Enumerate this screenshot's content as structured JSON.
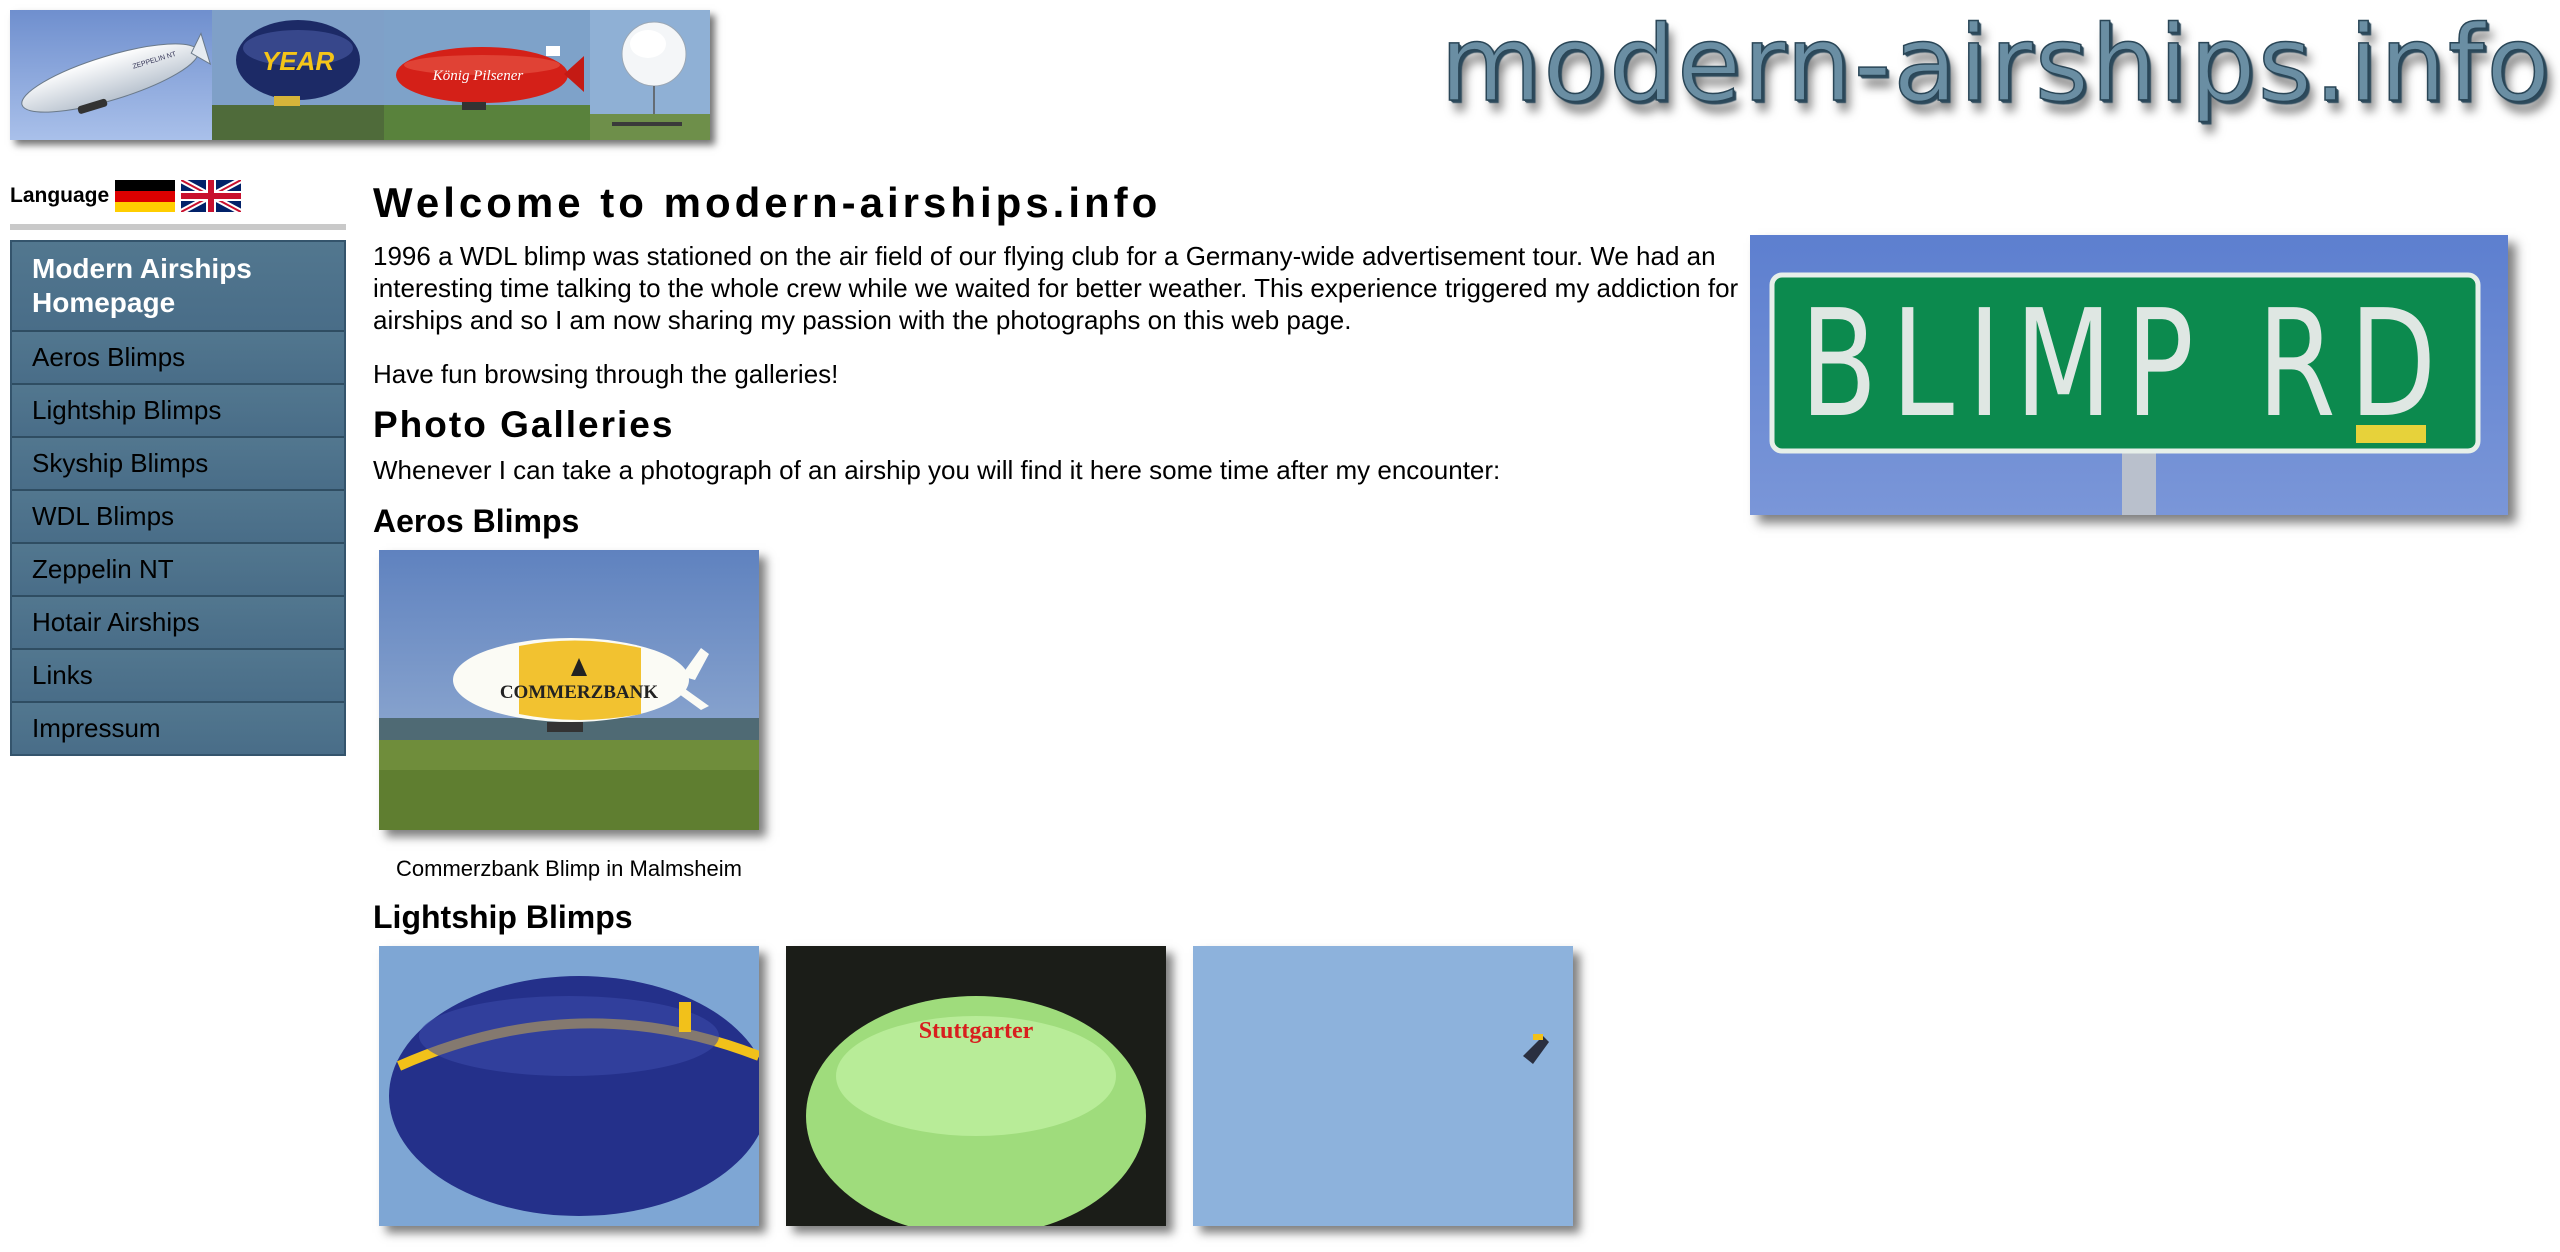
{
  "header": {
    "site_title": "modern-airships.info",
    "banner_photos": [
      {
        "name": "banner-zeppelin-photo",
        "lettering": "ZEPPELIN NT"
      },
      {
        "name": "banner-goodyear-photo",
        "lettering": "YEAR"
      },
      {
        "name": "banner-koenig-pilsener-photo",
        "lettering": "König Pilsener"
      },
      {
        "name": "banner-white-airship-photo",
        "lettering": ""
      }
    ]
  },
  "sidebar": {
    "language_label": "Language",
    "flags": [
      {
        "name": "german-flag-icon",
        "language": "de"
      },
      {
        "name": "uk-flag-icon",
        "language": "en"
      }
    ],
    "nav_items": [
      {
        "label": "Modern Airships Homepage",
        "active": true
      },
      {
        "label": "Aeros Blimps"
      },
      {
        "label": "Lightship Blimps"
      },
      {
        "label": "Skyship Blimps"
      },
      {
        "label": "WDL Blimps"
      },
      {
        "label": "Zeppelin NT"
      },
      {
        "label": "Hotair Airships"
      },
      {
        "label": "Links"
      },
      {
        "label": "Impressum"
      }
    ]
  },
  "main": {
    "title": "Welcome to modern-airships.info",
    "intro": "1996 a WDL blimp was stationed on the air field of our flying club for a Germany-wide advertisement tour. We had an interesting time talking to the whole crew while we waited for better weather. This experience triggered my addiction for airships and so I am now sharing my passion with the photographs on this web page.",
    "fun": "Have fun browsing through the galleries!",
    "galleries_heading": "Photo Galleries",
    "galleries_intro": "Whenever I can take a photograph of an airship you will find it here some time after my encounter:",
    "side_photo_lettering": "BLIMP RD",
    "sections": [
      {
        "heading": "Aeros Blimps",
        "photos": [
          {
            "caption": "Commerzbank Blimp in Malmsheim",
            "lettering": "COMMERZBANK"
          }
        ]
      },
      {
        "heading": "Lightship Blimps",
        "photos": [
          {
            "caption": ""
          },
          {
            "caption": "",
            "lettering": "Stuttgarter"
          },
          {
            "caption": ""
          }
        ]
      }
    ]
  },
  "colors": {
    "nav_background": "#4a6f8c",
    "nav_border": "#2f4d62",
    "logo_text": "#6a8ea3",
    "sign_green": "#0c8a4e"
  }
}
